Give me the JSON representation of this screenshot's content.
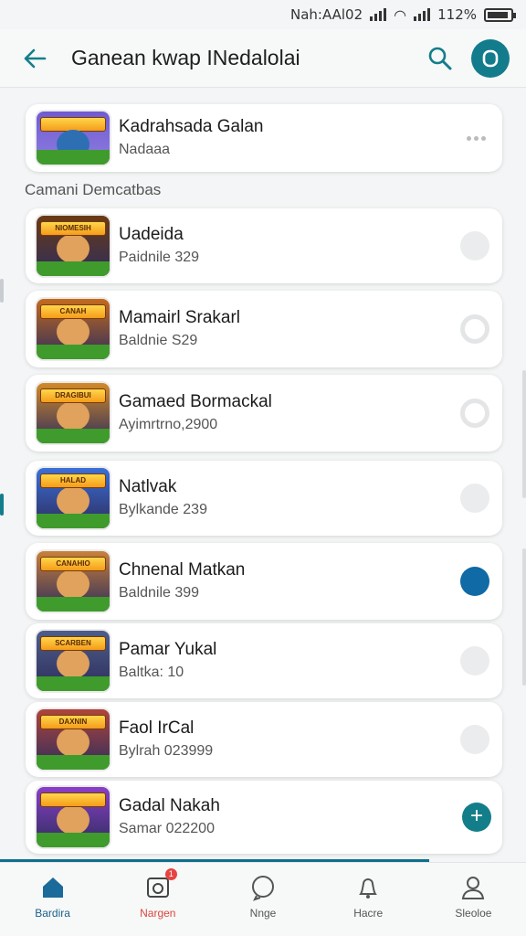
{
  "status_bar": {
    "left_text": "Nah:AAl02",
    "battery": "112%"
  },
  "header": {
    "title": "Ganean kwap INedalolai"
  },
  "featured": {
    "title": "Kadrahsada Galan",
    "subtitle": "Nadaaa"
  },
  "section_label": "Camani Demcatbas",
  "games": [
    {
      "title": "Uadeida",
      "subtitle": "Paidnile 329",
      "banner": "NIOMESIH",
      "state": "off",
      "accent": "#6b3a14"
    },
    {
      "title": "Mamairl Srakarl",
      "subtitle": "Baldnie S29",
      "banner": "CANAH",
      "state": "ring",
      "accent": "#c46a1e"
    },
    {
      "title": "Gamaed Bormackal",
      "subtitle": "Ayimrtrno,2900",
      "banner": "DRAGIBUI",
      "state": "ring",
      "accent": "#d28a2a"
    },
    {
      "title": "Natlvak",
      "subtitle": "Bylkande 239",
      "banner": "HALAD",
      "state": "off",
      "accent": "#3b6fd8"
    },
    {
      "title": "Chnenal Matkan",
      "subtitle": "Baldnile 399",
      "banner": "CANAHIO",
      "state": "on",
      "accent": "#c9803a"
    },
    {
      "title": "Pamar Yukal",
      "subtitle": "Baltka: 10",
      "banner": "SCARBEN",
      "state": "off",
      "accent": "#4e5e8a"
    },
    {
      "title": "Faol IrCal",
      "subtitle": "Bylrah 023999",
      "banner": "DAXNIN",
      "state": "off",
      "accent": "#b0443c"
    },
    {
      "title": "Gadal Nakah",
      "subtitle": "Samar 022200",
      "banner": "",
      "state": "add",
      "accent": "#8a3fc8"
    }
  ],
  "nav": [
    {
      "label": "Bardira",
      "icon": "home-icon",
      "active": true
    },
    {
      "label": "Nargen",
      "icon": "store-icon",
      "badge": "1"
    },
    {
      "label": "Nnge",
      "icon": "chat-icon"
    },
    {
      "label": "Hacre",
      "icon": "bell-icon"
    },
    {
      "label": "Sleoloe",
      "icon": "user-icon"
    }
  ],
  "colors": {
    "accent": "#127c8c",
    "selected": "#0f6aa6",
    "badge": "#e64440"
  }
}
